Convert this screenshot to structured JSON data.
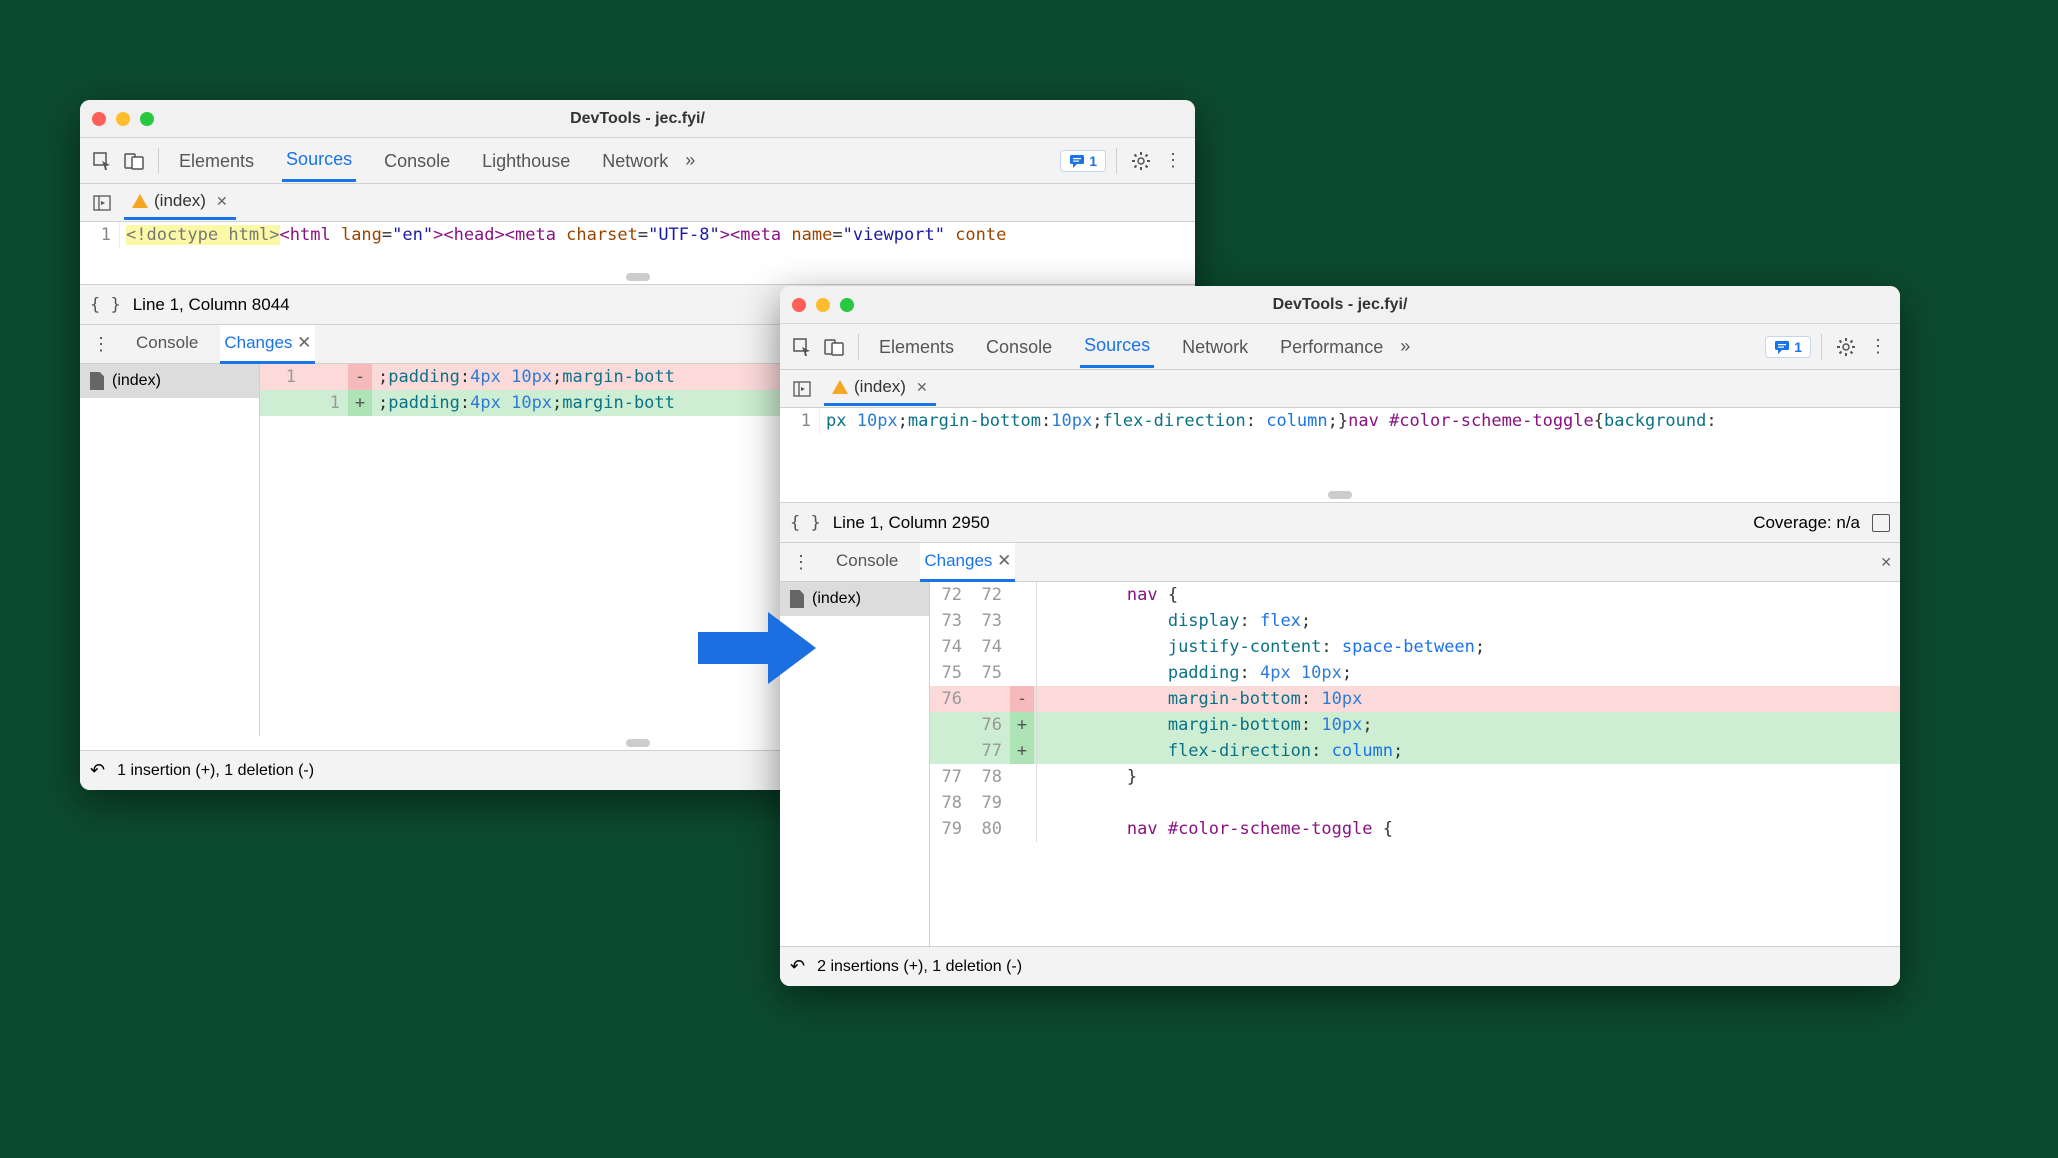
{
  "title": "DevTools - jec.fyi/",
  "msg_count": "1",
  "more_glyph": "»",
  "window_a": {
    "tabs": [
      "Elements",
      "Sources",
      "Console",
      "Lighthouse",
      "Network"
    ],
    "active_tab_index": 1,
    "file_tab": "(index)",
    "code_line_no": "1",
    "code_doctype": "<!doctype html>",
    "code_rest_tokens": [
      {
        "t": "tag",
        "v": "<html "
      },
      {
        "t": "attr",
        "v": "lang"
      },
      {
        "t": "punc",
        "v": "="
      },
      {
        "t": "str",
        "v": "\"en\""
      },
      {
        "t": "tag",
        "v": "><head><meta "
      },
      {
        "t": "attr",
        "v": "charset"
      },
      {
        "t": "punc",
        "v": "="
      },
      {
        "t": "str",
        "v": "\"UTF-8\""
      },
      {
        "t": "tag",
        "v": "><meta "
      },
      {
        "t": "attr",
        "v": "name"
      },
      {
        "t": "punc",
        "v": "="
      },
      {
        "t": "str",
        "v": "\"viewport\""
      },
      {
        "t": "attr",
        "v": " conte"
      }
    ],
    "status": "Line 1, Column 8044",
    "drawer_tabs": [
      "Console",
      "Changes"
    ],
    "drawer_active_index": 1,
    "side_file": "(index)",
    "diff": [
      {
        "l": "1",
        "r": "",
        "m": "-",
        "cls": "row-del",
        "txt": ";padding:4px 10px;margin-bott"
      },
      {
        "l": "",
        "r": "1",
        "m": "+",
        "cls": "row-add",
        "txt": ";padding:4px 10px;margin-bott"
      }
    ],
    "footer": "1 insertion (+), 1 deletion (-)"
  },
  "window_b": {
    "tabs": [
      "Elements",
      "Console",
      "Sources",
      "Network",
      "Performance"
    ],
    "active_tab_index": 2,
    "file_tab": "(index)",
    "code_line_no": "1",
    "code_tokens": [
      {
        "t": "prop",
        "v": "px "
      },
      {
        "t": "num",
        "v": "10px"
      },
      {
        "t": "punc",
        "v": ";"
      },
      {
        "t": "prop",
        "v": "margin-bottom"
      },
      {
        "t": "punc",
        "v": ":"
      },
      {
        "t": "num",
        "v": "10px"
      },
      {
        "t": "punc",
        "v": ";"
      },
      {
        "t": "prop",
        "v": "flex-direction"
      },
      {
        "t": "punc",
        "v": ": "
      },
      {
        "t": "kw",
        "v": "column"
      },
      {
        "t": "punc",
        "v": ";}"
      },
      {
        "t": "sel",
        "v": "nav #color-scheme-toggle"
      },
      {
        "t": "punc",
        "v": "{"
      },
      {
        "t": "prop",
        "v": "background"
      },
      {
        "t": "punc",
        "v": ":"
      }
    ],
    "status": "Line 1, Column 2950",
    "coverage": "Coverage: n/a",
    "drawer_tabs": [
      "Console",
      "Changes"
    ],
    "drawer_active_index": 1,
    "side_file": "(index)",
    "diff_b": [
      {
        "l": "72",
        "r": "72",
        "m": "",
        "cls": "",
        "tok": [
          {
            "t": "sel",
            "v": "nav "
          },
          {
            "t": "punc",
            "v": "{"
          }
        ],
        "ind": "        "
      },
      {
        "l": "73",
        "r": "73",
        "m": "",
        "cls": "",
        "tok": [
          {
            "t": "prop",
            "v": "display"
          },
          {
            "t": "punc",
            "v": ": "
          },
          {
            "t": "kw",
            "v": "flex"
          },
          {
            "t": "punc",
            "v": ";"
          }
        ],
        "ind": "            "
      },
      {
        "l": "74",
        "r": "74",
        "m": "",
        "cls": "",
        "tok": [
          {
            "t": "prop",
            "v": "justify-content"
          },
          {
            "t": "punc",
            "v": ": "
          },
          {
            "t": "kw",
            "v": "space-between"
          },
          {
            "t": "punc",
            "v": ";"
          }
        ],
        "ind": "            "
      },
      {
        "l": "75",
        "r": "75",
        "m": "",
        "cls": "",
        "tok": [
          {
            "t": "prop",
            "v": "padding"
          },
          {
            "t": "punc",
            "v": ": "
          },
          {
            "t": "num",
            "v": "4px 10px"
          },
          {
            "t": "punc",
            "v": ";"
          }
        ],
        "ind": "            "
      },
      {
        "l": "76",
        "r": "",
        "m": "-",
        "cls": "row-del",
        "tok": [
          {
            "t": "prop",
            "v": "margin-bottom"
          },
          {
            "t": "punc",
            "v": ": "
          },
          {
            "t": "num",
            "v": "10px"
          }
        ],
        "ind": "            "
      },
      {
        "l": "",
        "r": "76",
        "m": "+",
        "cls": "row-add",
        "tok": [
          {
            "t": "prop",
            "v": "margin-bottom"
          },
          {
            "t": "punc",
            "v": ": "
          },
          {
            "t": "num",
            "v": "10px"
          },
          {
            "t": "punc",
            "v": ";"
          }
        ],
        "ind": "            "
      },
      {
        "l": "",
        "r": "77",
        "m": "+",
        "cls": "row-add",
        "tok": [
          {
            "t": "prop",
            "v": "flex-direction"
          },
          {
            "t": "punc",
            "v": ": "
          },
          {
            "t": "kw",
            "v": "column"
          },
          {
            "t": "punc",
            "v": ";"
          }
        ],
        "ind": "            "
      },
      {
        "l": "77",
        "r": "78",
        "m": "",
        "cls": "",
        "tok": [
          {
            "t": "punc",
            "v": "}"
          }
        ],
        "ind": "        "
      },
      {
        "l": "78",
        "r": "79",
        "m": "",
        "cls": "",
        "tok": [],
        "ind": ""
      },
      {
        "l": "79",
        "r": "80",
        "m": "",
        "cls": "",
        "tok": [
          {
            "t": "sel",
            "v": "nav #color-scheme-toggle "
          },
          {
            "t": "punc",
            "v": "{"
          }
        ],
        "ind": "        "
      }
    ],
    "footer": "2 insertions (+), 1 deletion (-)"
  }
}
